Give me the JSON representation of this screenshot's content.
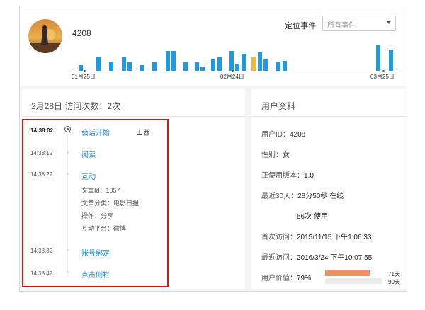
{
  "header": {
    "user_id": "4208",
    "locate_label": "定位事件:",
    "select_value": "所有事件"
  },
  "timeline_chart": {
    "x_labels": [
      "01月25日",
      "02月24日",
      "03月25日"
    ],
    "highlight_color": "#f0b92e",
    "bar_color": "#1d9ae0"
  },
  "visit": {
    "title": "2月28日  访问次数：2次",
    "events": [
      {
        "time": "14:38:02",
        "name": "会话开始",
        "location": "山西"
      },
      {
        "time": "14:38:12",
        "name": "阅读"
      },
      {
        "time": "14:38:22",
        "name": "互动",
        "details": [
          "文章Id：1057",
          "文章分类：电影日报",
          "操作：分享",
          "互动平台：微博"
        ]
      },
      {
        "time": "14:38:32",
        "name": "账号绑定"
      },
      {
        "time": "14:38:42",
        "name": "点击侧栏"
      }
    ]
  },
  "profile": {
    "title": "用户资料",
    "user_id": {
      "label": "用户ID：",
      "value": "4208"
    },
    "gender": {
      "label": "性别：",
      "value": "女"
    },
    "version": {
      "label": "正使用版本：",
      "value": "1.0"
    },
    "last30": {
      "label": "最近30天：",
      "value": "28分50秒 在线"
    },
    "last30_uses": "56次 使用",
    "first_visit": {
      "label": "首次访问：",
      "value": "2015/11/15 下午1:06:33"
    },
    "last_visit": {
      "label": "最近访问：",
      "value": "2016/3/24 下午10:07:55"
    },
    "value_label": "用户价值：",
    "value_pct": "79%",
    "value_fraction": 0.79,
    "bar_labels": [
      "71天",
      "90天"
    ]
  }
}
